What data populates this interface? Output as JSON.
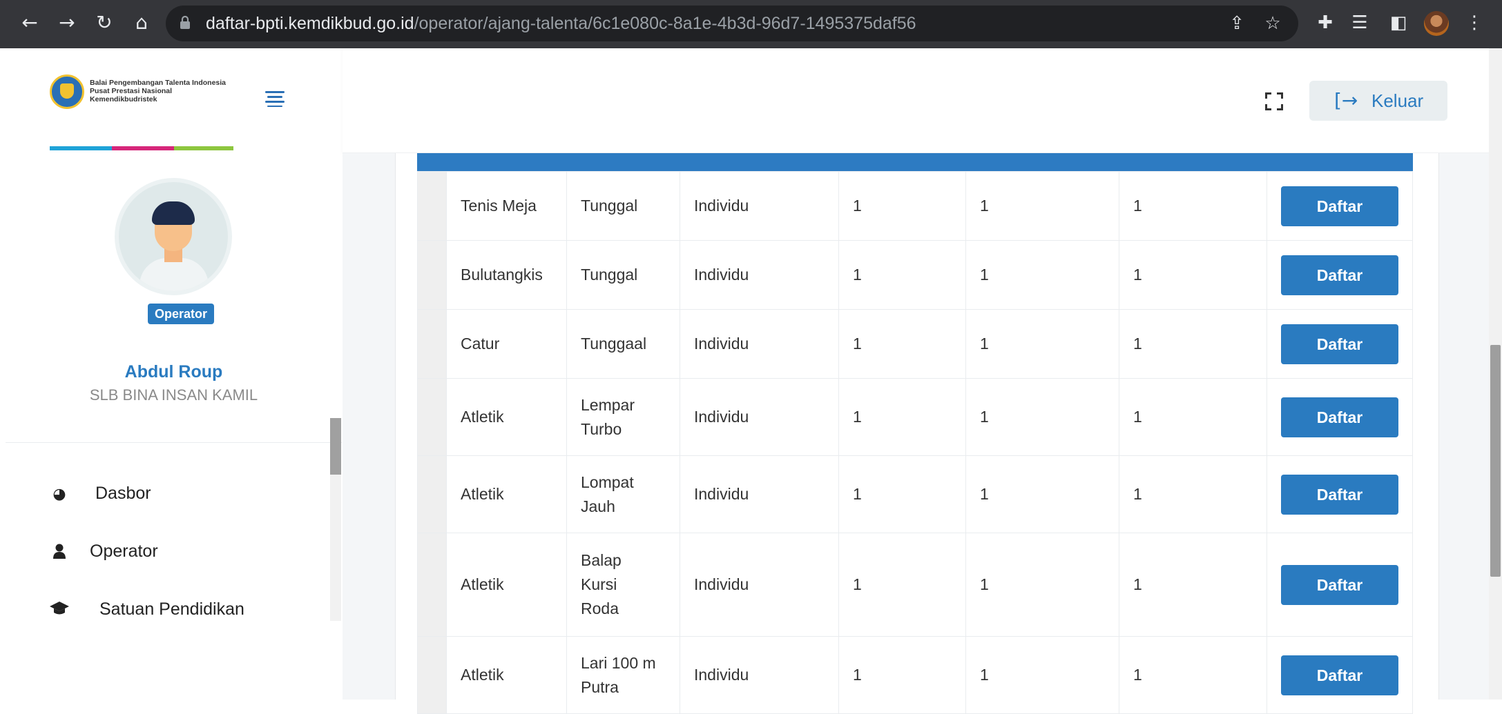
{
  "browser": {
    "url_domain": "daftar-bpti.kemdikbud.go.id",
    "url_path": "/operator/ajang-talenta/6c1e080c-8a1e-4b3d-96d7-1495375daf56"
  },
  "brand": {
    "logo_line1": "Balai Pengembangan Talenta Indonesia",
    "logo_line2": "Pusat Prestasi Nasional",
    "logo_line3": "Kemendikbudristek",
    "bar_colors": [
      "#1fa3d8",
      "#d6267a",
      "#8dc63f"
    ]
  },
  "profile": {
    "role": "Operator",
    "name": "Abdul Roup",
    "school": "SLB BINA INSAN KAMIL"
  },
  "menu": [
    {
      "label": "Dasbor",
      "icon": "dashboard-icon"
    },
    {
      "label": "Operator",
      "icon": "user-icon"
    },
    {
      "label": "Satuan Pendidikan",
      "icon": "graduation-cap-icon"
    }
  ],
  "header": {
    "logout_label": "Keluar"
  },
  "colors": {
    "accent": "#2a7bc0",
    "table_header": "#2d7bc2"
  },
  "table": {
    "button_label": "Daftar",
    "rows": [
      {
        "cabang": "Tenis Meja",
        "nomor": "Tunggal",
        "jenis": "Individu",
        "c1": "1",
        "c2": "1",
        "c3": "1"
      },
      {
        "cabang": "Bulutangkis",
        "nomor": "Tunggal",
        "jenis": "Individu",
        "c1": "1",
        "c2": "1",
        "c3": "1"
      },
      {
        "cabang": "Catur",
        "nomor": "Tunggaal",
        "jenis": "Individu",
        "c1": "1",
        "c2": "1",
        "c3": "1"
      },
      {
        "cabang": "Atletik",
        "nomor": "Lempar Turbo",
        "jenis": "Individu",
        "c1": "1",
        "c2": "1",
        "c3": "1"
      },
      {
        "cabang": "Atletik",
        "nomor": "Lompat Jauh",
        "jenis": "Individu",
        "c1": "1",
        "c2": "1",
        "c3": "1"
      },
      {
        "cabang": "Atletik",
        "nomor": "Balap Kursi Roda",
        "jenis": "Individu",
        "c1": "1",
        "c2": "1",
        "c3": "1"
      },
      {
        "cabang": "Atletik",
        "nomor": "Lari 100 m Putra",
        "jenis": "Individu",
        "c1": "1",
        "c2": "1",
        "c3": "1"
      }
    ]
  }
}
